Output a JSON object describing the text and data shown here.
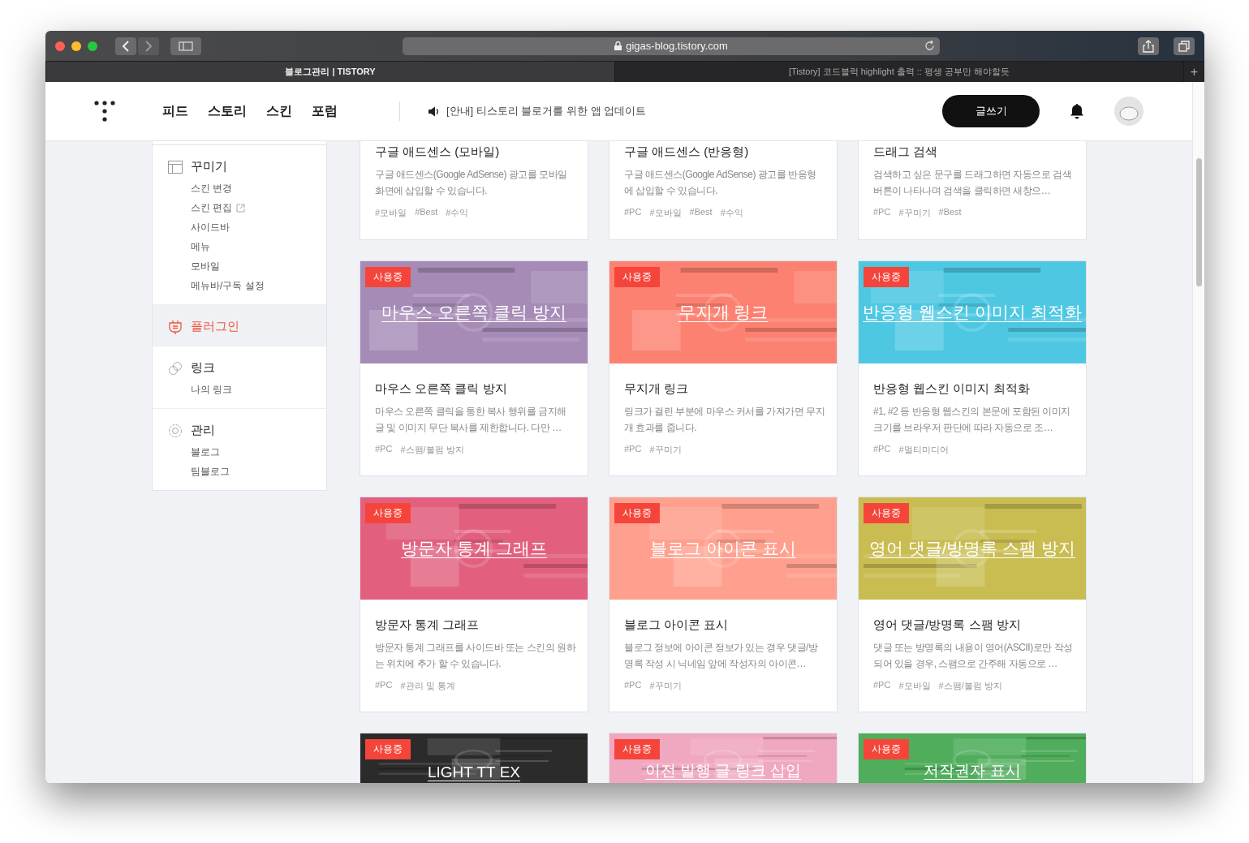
{
  "browser": {
    "url": "gigas-blog.tistory.com",
    "tabs": [
      {
        "label": "블로그관리 | TISTORY",
        "selected": true
      },
      {
        "label": "[Tistory] 코드블럭 highlight 출력 :: 평생 공부만 해야할듯",
        "selected": false
      }
    ],
    "new_tab": "+"
  },
  "header": {
    "nav": [
      "피드",
      "스토리",
      "스킨",
      "포럼"
    ],
    "notice": "[안내] 티스토리 블로거를 위한 앱 업데이트",
    "write_button": "글쓰기"
  },
  "sidebar": {
    "groups": [
      {
        "kind": "layout",
        "label": "꾸미기",
        "selected": false,
        "children": [
          {
            "label": "스킨 변경",
            "external": false
          },
          {
            "label": "스킨 편집",
            "external": true
          },
          {
            "label": "사이드바",
            "external": false
          },
          {
            "label": "메뉴",
            "external": false
          },
          {
            "label": "모바일",
            "external": false
          },
          {
            "label": "메뉴바/구독 설정",
            "external": false
          }
        ]
      },
      {
        "kind": "plugin",
        "label": "플러그인",
        "selected": true
      },
      {
        "kind": "link",
        "label": "링크",
        "selected": false,
        "children": [
          {
            "label": "나의 링크",
            "external": false
          }
        ]
      },
      {
        "kind": "settings",
        "label": "관리",
        "selected": false,
        "children": [
          {
            "label": "블로그",
            "external": false
          },
          {
            "label": "팀블로그",
            "external": false
          }
        ]
      }
    ]
  },
  "plugin_rows": [
    {
      "kind": "body",
      "cards": [
        {
          "title": "구글 애드센스 (모바일)",
          "description": "구글 애드센스(Google AdSense) 광고를 모바일 화면에 삽입할 수 있습니다.",
          "tags": [
            "#모바일",
            "#Best",
            "#수익"
          ]
        },
        {
          "title": "구글 애드센스 (반응형)",
          "description": "구글 애드센스(Google AdSense) 광고를 반응형에 삽입할 수 있습니다.",
          "tags": [
            "#PC",
            "#모바일",
            "#Best",
            "#수익"
          ]
        },
        {
          "title": "드래그 검색",
          "description": "검색하고 싶은 문구를 드래그하면 자동으로 검색 버튼이 나타나며 검색을 클릭하면 새창으…",
          "tags": [
            "#PC",
            "#꾸미기",
            "#Best"
          ]
        }
      ]
    },
    {
      "kind": "full",
      "cards": [
        {
          "badge": "사용중",
          "banner": "마우스 오른쪽 클릭 방지",
          "color": "#a58bb6",
          "title": "마우스 오른쪽 클릭 방지",
          "description": "마우스 오른쪽 클릭을 통한 복사 행위를 금지해 글 및 이미지 무단 복사를 제한합니다. 다만 …",
          "tags": [
            "#PC",
            "#스팸/불펌 방지"
          ]
        },
        {
          "badge": "사용중",
          "banner": "무지개 링크",
          "color": "#fc8170",
          "title": "무지개 링크",
          "description": "링크가 걸린 부분에 마우스 커서를 가져가면 무지개 효과를 줍니다.",
          "tags": [
            "#PC",
            "#꾸미기"
          ]
        },
        {
          "badge": "사용중",
          "banner": "반응형 웹스킨 이미지 최적화",
          "color": "#4ec8e2",
          "title": "반응형 웹스킨 이미지 최적화",
          "description": "#1, #2 등 반응형 웹스킨의 본문에 포함된 이미지 크기를 브라우저 판단에 따라 자동으로 조…",
          "tags": [
            "#PC",
            "#멀티미디어"
          ]
        }
      ]
    },
    {
      "kind": "full",
      "cards": [
        {
          "badge": "사용중",
          "banner": "방문자 통계 그래프",
          "color": "#e2607e",
          "title": "방문자 통계 그래프",
          "description": "방문자 통계 그래프를 사이드바 또는 스킨의 원하는 위치에 추가 할 수 있습니다.",
          "tags": [
            "#PC",
            "#관리 및 통계"
          ]
        },
        {
          "badge": "사용중",
          "banner": "블로그 아이콘 표시",
          "color": "#ffa08e",
          "title": "블로그 아이콘 표시",
          "description": "블로그 정보에 아이콘 정보가 있는 경우 댓글/방명록 작성 시 닉네임 앞에 작성자의 아이콘…",
          "tags": [
            "#PC",
            "#꾸미기"
          ]
        },
        {
          "badge": "사용중",
          "banner": "영어 댓글/방명록 스팸 방지",
          "color": "#c9bd52",
          "title": "영어 댓글/방명록 스팸 방지",
          "description": "댓글 또는 방명록의 내용이 영어(ASCII)로만 작성되어 있을 경우, 스팸으로 간주해 자동으로 …",
          "tags": [
            "#PC",
            "#모바일",
            "#스팸/불펌 방지"
          ]
        }
      ]
    },
    {
      "kind": "banner",
      "cards": [
        {
          "badge": "사용중",
          "banner": "LIGHT TT EX",
          "color": "#2b2b2b"
        },
        {
          "badge": "사용중",
          "banner": "이전 발행 글 링크 삽입",
          "color": "#f0a8c0"
        },
        {
          "badge": "사용중",
          "banner": "저작권자 표시",
          "color": "#4fad5b"
        }
      ]
    }
  ]
}
